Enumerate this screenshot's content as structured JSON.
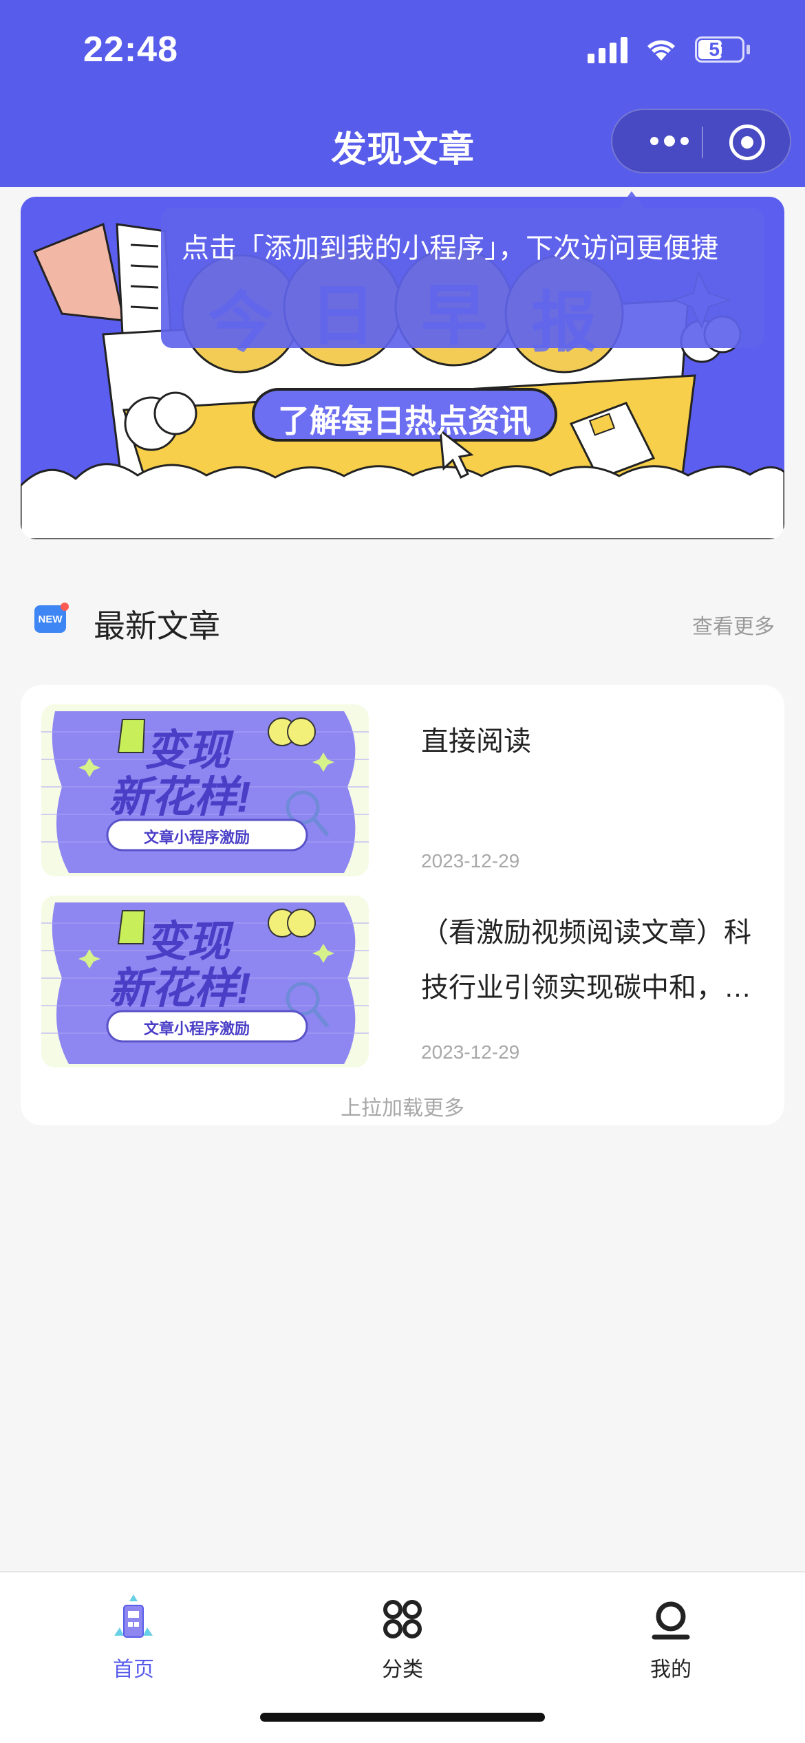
{
  "status_bar": {
    "time": "22:48",
    "battery": "51"
  },
  "nav": {
    "title": "发现文章"
  },
  "banner": {
    "headline_chars": [
      "今",
      "日",
      "早",
      "报"
    ],
    "subtitle": "了解每日热点资讯"
  },
  "tooltip": {
    "text": "点击「添加到我的小程序」，下次访问更便捷"
  },
  "section": {
    "icon_text": "NEW",
    "title": "最新文章",
    "more": "查看更多"
  },
  "articles": [
    {
      "title": "直接阅读",
      "date": "2023-12-29",
      "thumb": {
        "line1": "变现",
        "line2": "新花样!",
        "tag": "文章小程序激励"
      }
    },
    {
      "title": "（看激励视频阅读文章）科技行业引领实现碳中和，从绿色能源到节能技术的创新应用",
      "date": "2023-12-29",
      "thumb": {
        "line1": "变现",
        "line2": "新花样!",
        "tag": "文章小程序激励"
      }
    }
  ],
  "list_footer": "上拉加载更多",
  "tabbar": {
    "items": [
      {
        "label": "首页",
        "icon": "home-icon",
        "active": true
      },
      {
        "label": "分类",
        "icon": "category-icon",
        "active": false
      },
      {
        "label": "我的",
        "icon": "profile-icon",
        "active": false
      }
    ],
    "active_color": "#585ceb"
  },
  "colors": {
    "brand": "#585ceb",
    "banner_yellow": "#f7cf4a",
    "thumb_purple": "#8f87f1"
  }
}
